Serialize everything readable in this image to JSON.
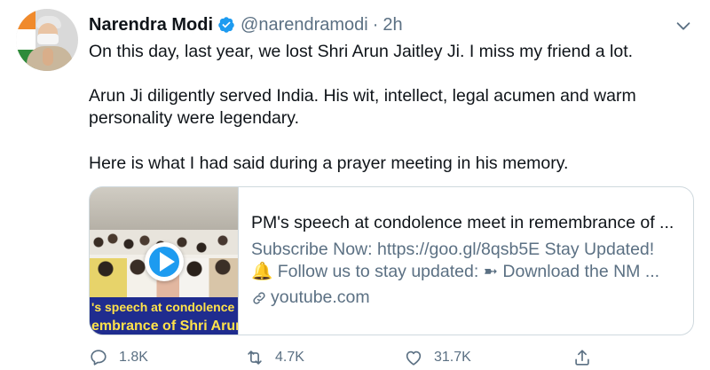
{
  "author": {
    "name": "Narendra Modi",
    "handle": "@narendramodi",
    "separator": "·",
    "time": "2h",
    "verified": true
  },
  "tweet": {
    "line1": "On this day, last year, we lost Shri Arun Jaitley Ji. I miss my friend a lot.",
    "line2": "Arun Ji diligently served India. His wit, intellect, legal acumen and warm",
    "line3": "personality were legendary.",
    "line4": "Here is what I had said during a prayer meeting in his memory."
  },
  "card": {
    "thumbnail_caption_1": "'s speech at condolence me",
    "thumbnail_caption_2": "embrance of Shri Arun J",
    "title": "PM's speech at condolence meet in remembrance of ...",
    "description_1": "Subscribe Now: https://goo.gl/8qsb5E Stay Updated!",
    "description_2": "🔔 Follow us to stay updated: ➼ Download the NM ...",
    "domain": "youtube.com"
  },
  "actions": {
    "replies": "1.8K",
    "retweets": "4.7K",
    "likes": "31.7K"
  },
  "icons": {
    "verified": "verified-badge-icon",
    "caret": "chevron-down-icon",
    "play": "play-icon",
    "link": "link-icon",
    "reply": "reply-icon",
    "retweet": "retweet-icon",
    "like": "heart-icon",
    "share": "share-icon"
  },
  "colors": {
    "accent": "#1d9bf0",
    "secondary_text": "#5b7083",
    "border": "#cfd9de"
  }
}
